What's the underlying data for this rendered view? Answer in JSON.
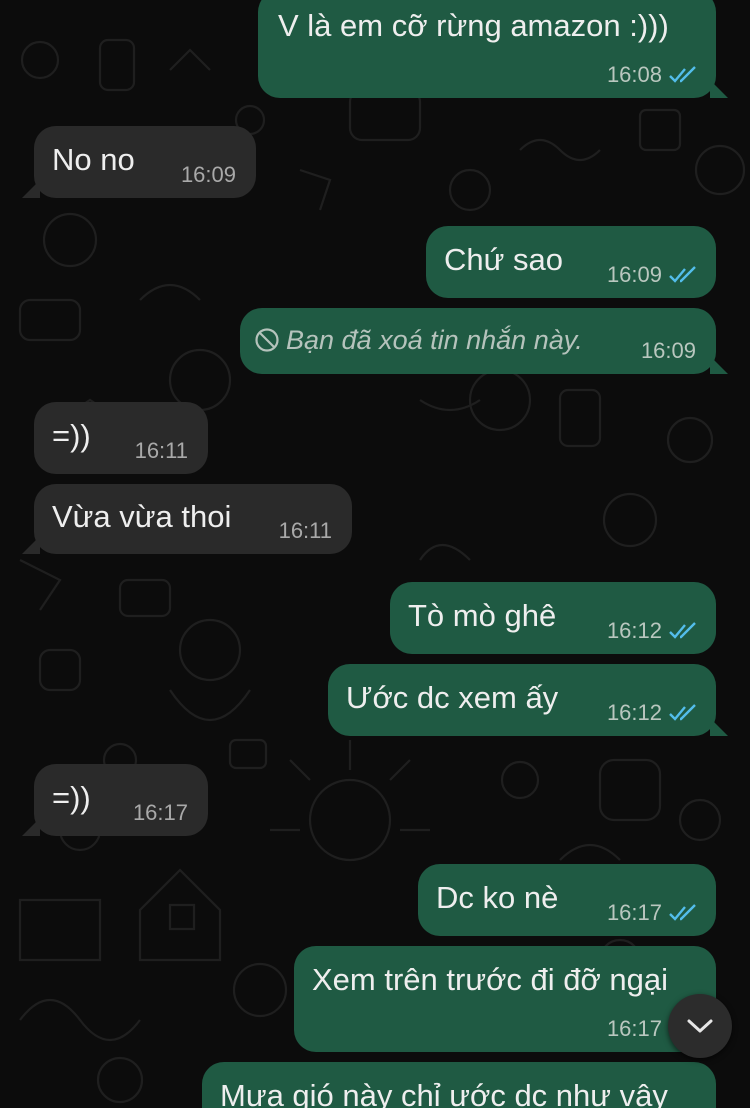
{
  "messages": [
    {
      "text": "V là em cỡ rừng amazon :)))",
      "time": "16:08",
      "direction": "out",
      "status": "read"
    },
    {
      "text": "No no",
      "time": "16:09",
      "direction": "in"
    },
    {
      "text": "Chứ sao",
      "time": "16:09",
      "direction": "out",
      "status": "read"
    },
    {
      "text": "Bạn đã xoá tin nhắn này.",
      "time": "16:09",
      "direction": "out",
      "deleted": true
    },
    {
      "text": "=))",
      "time": "16:11",
      "direction": "in"
    },
    {
      "text": "Vừa vừa thoi",
      "time": "16:11",
      "direction": "in"
    },
    {
      "text": "Tò mò ghê",
      "time": "16:12",
      "direction": "out",
      "status": "read"
    },
    {
      "text": "Ước dc xem ấy",
      "time": "16:12",
      "direction": "out",
      "status": "read"
    },
    {
      "text": "=))",
      "time": "16:17",
      "direction": "in"
    },
    {
      "text": "Dc ko nè",
      "time": "16:17",
      "direction": "out",
      "status": "read"
    },
    {
      "text": "Xem trên trước đi đỡ ngại",
      "time": "16:17",
      "direction": "out",
      "status": "read"
    },
    {
      "text": "Mưa gió này chỉ ước dc như vậy",
      "time": "",
      "direction": "out"
    }
  ],
  "icons": {
    "read_ticks": "double-check-icon",
    "deleted": "ban-icon",
    "scroll": "chevron-down-icon"
  },
  "colors": {
    "outgoing_bubble": "#1f5a43",
    "incoming_bubble": "#2a2a2a",
    "read_tick": "#53bdeb",
    "background": "#0c0c0c"
  }
}
